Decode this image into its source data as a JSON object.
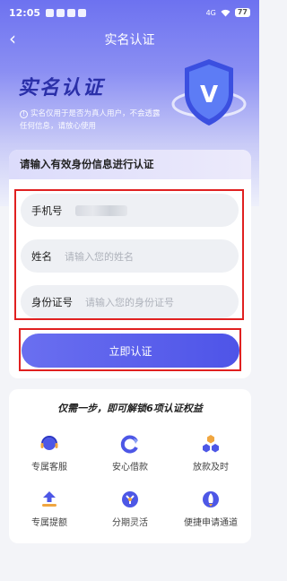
{
  "status_bar": {
    "time": "12:05",
    "network": "4G",
    "battery": "77"
  },
  "navbar": {
    "title": "实名认证"
  },
  "hero": {
    "title": "实名认证",
    "note": "实名仅用于是否为真人用户，不会透露任何信息，请放心使用",
    "shield_letter": "V"
  },
  "form": {
    "heading": "请输入有效身份信息进行认证",
    "phone": {
      "label": "手机号",
      "value": ""
    },
    "name": {
      "label": "姓名",
      "placeholder": "请输入您的姓名"
    },
    "id_number": {
      "label": "身份证号",
      "placeholder": "请输入您的身份证号"
    },
    "submit_label": "立即认证"
  },
  "benefits": {
    "title": "仅需一步，即可解锁6项认证权益",
    "items": [
      {
        "label": "专属客服",
        "icon": "headset-icon"
      },
      {
        "label": "安心借款",
        "icon": "refresh-icon"
      },
      {
        "label": "放款及时",
        "icon": "hexagons-icon"
      },
      {
        "label": "专属提额",
        "icon": "arrow-up-icon"
      },
      {
        "label": "分期灵活",
        "icon": "split-icon"
      },
      {
        "label": "便捷申请通道",
        "icon": "rocket-icon"
      }
    ]
  },
  "colors": {
    "accent": "#5a5fea",
    "highlight_border": "#e02020"
  }
}
